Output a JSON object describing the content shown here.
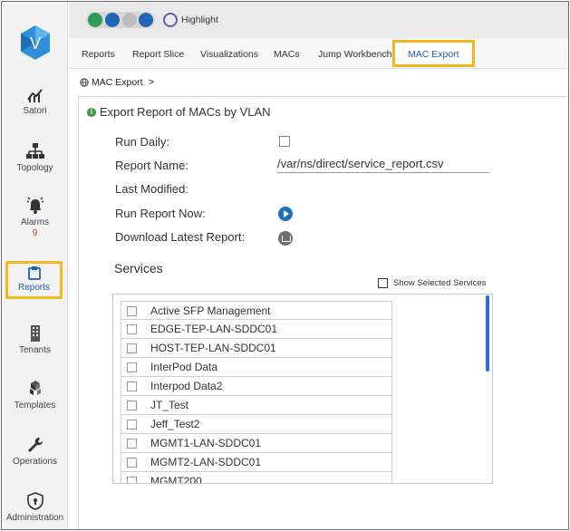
{
  "sidebar": {
    "items": [
      {
        "label": "Satori"
      },
      {
        "label": "Topology"
      },
      {
        "label": "Alarms",
        "badge": "9"
      },
      {
        "label": "Reports"
      },
      {
        "label": "Tenants"
      },
      {
        "label": "Templates"
      },
      {
        "label": "Operations"
      },
      {
        "label": "Administration"
      }
    ]
  },
  "toolbar": {
    "highlight_label": "Highlight"
  },
  "tabs": [
    {
      "label": "Reports"
    },
    {
      "label": "Report Slice"
    },
    {
      "label": "Visualizations"
    },
    {
      "label": "MACs"
    },
    {
      "label": "Jump Workbench"
    },
    {
      "label": "MAC Export"
    }
  ],
  "breadcrumb": {
    "label": "MAC Export",
    "separator": ">"
  },
  "form": {
    "title": "Export Report of MACs by VLAN",
    "run_daily_label": "Run Daily:",
    "report_name_label": "Report Name:",
    "report_name_value": "/var/ns/direct/service_report.csv",
    "last_modified_label": "Last Modified:",
    "run_now_label": "Run Report Now:",
    "download_label": "Download Latest Report:"
  },
  "services": {
    "heading": "Services",
    "show_selected_label": "Show Selected Services",
    "items": [
      "Active SFP Management",
      "EDGE-TEP-LAN-SDDC01",
      "HOST-TEP-LAN-SDDC01",
      "InterPod Data",
      "Interpod Data2",
      "JT_Test",
      "Jeff_Test2",
      "MGMT1-LAN-SDDC01",
      "MGMT2-LAN-SDDC01",
      "MGMT200"
    ]
  },
  "colors": {
    "accent_highlight": "#f5b71e",
    "link_blue": "#1d5fa8",
    "alarm_badge": "#d83a2a"
  }
}
